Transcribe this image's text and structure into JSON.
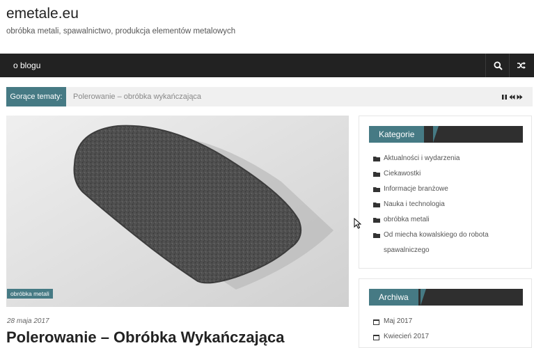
{
  "header": {
    "site_title": "emetale.eu",
    "site_description": "obróbka metali, spawalnictwo, produkcja elementów metalowych"
  },
  "navbar": {
    "items": [
      "o blogu"
    ],
    "search_icon": "search-icon",
    "shuffle_icon": "shuffle-icon"
  },
  "ticker": {
    "label": "Gorące tematy:",
    "headline": "Polerowanie – obróbka wykańczająca",
    "controls": [
      "pause-icon",
      "prev-icon",
      "next-icon"
    ]
  },
  "featured_post": {
    "category_badge": "obróbka metali",
    "date": "28 maja 2017",
    "title": "Polerowanie – Obróbka Wykańczająca"
  },
  "sidebar": {
    "categories": {
      "title": "Kategorie",
      "items": [
        "Aktualności i wydarzenia",
        "Ciekawostki",
        "Informacje branżowe",
        "Nauka i technologia",
        "obróbka metali",
        "Od miecha kowalskiego do robota spawalniczego"
      ]
    },
    "archives": {
      "title": "Archiwa",
      "items": [
        "Maj 2017",
        "Kwiecień 2017"
      ]
    }
  },
  "colors": {
    "accent": "#467a84",
    "navbar": "#222222",
    "widget_title_bar": "#2f2f2f"
  }
}
